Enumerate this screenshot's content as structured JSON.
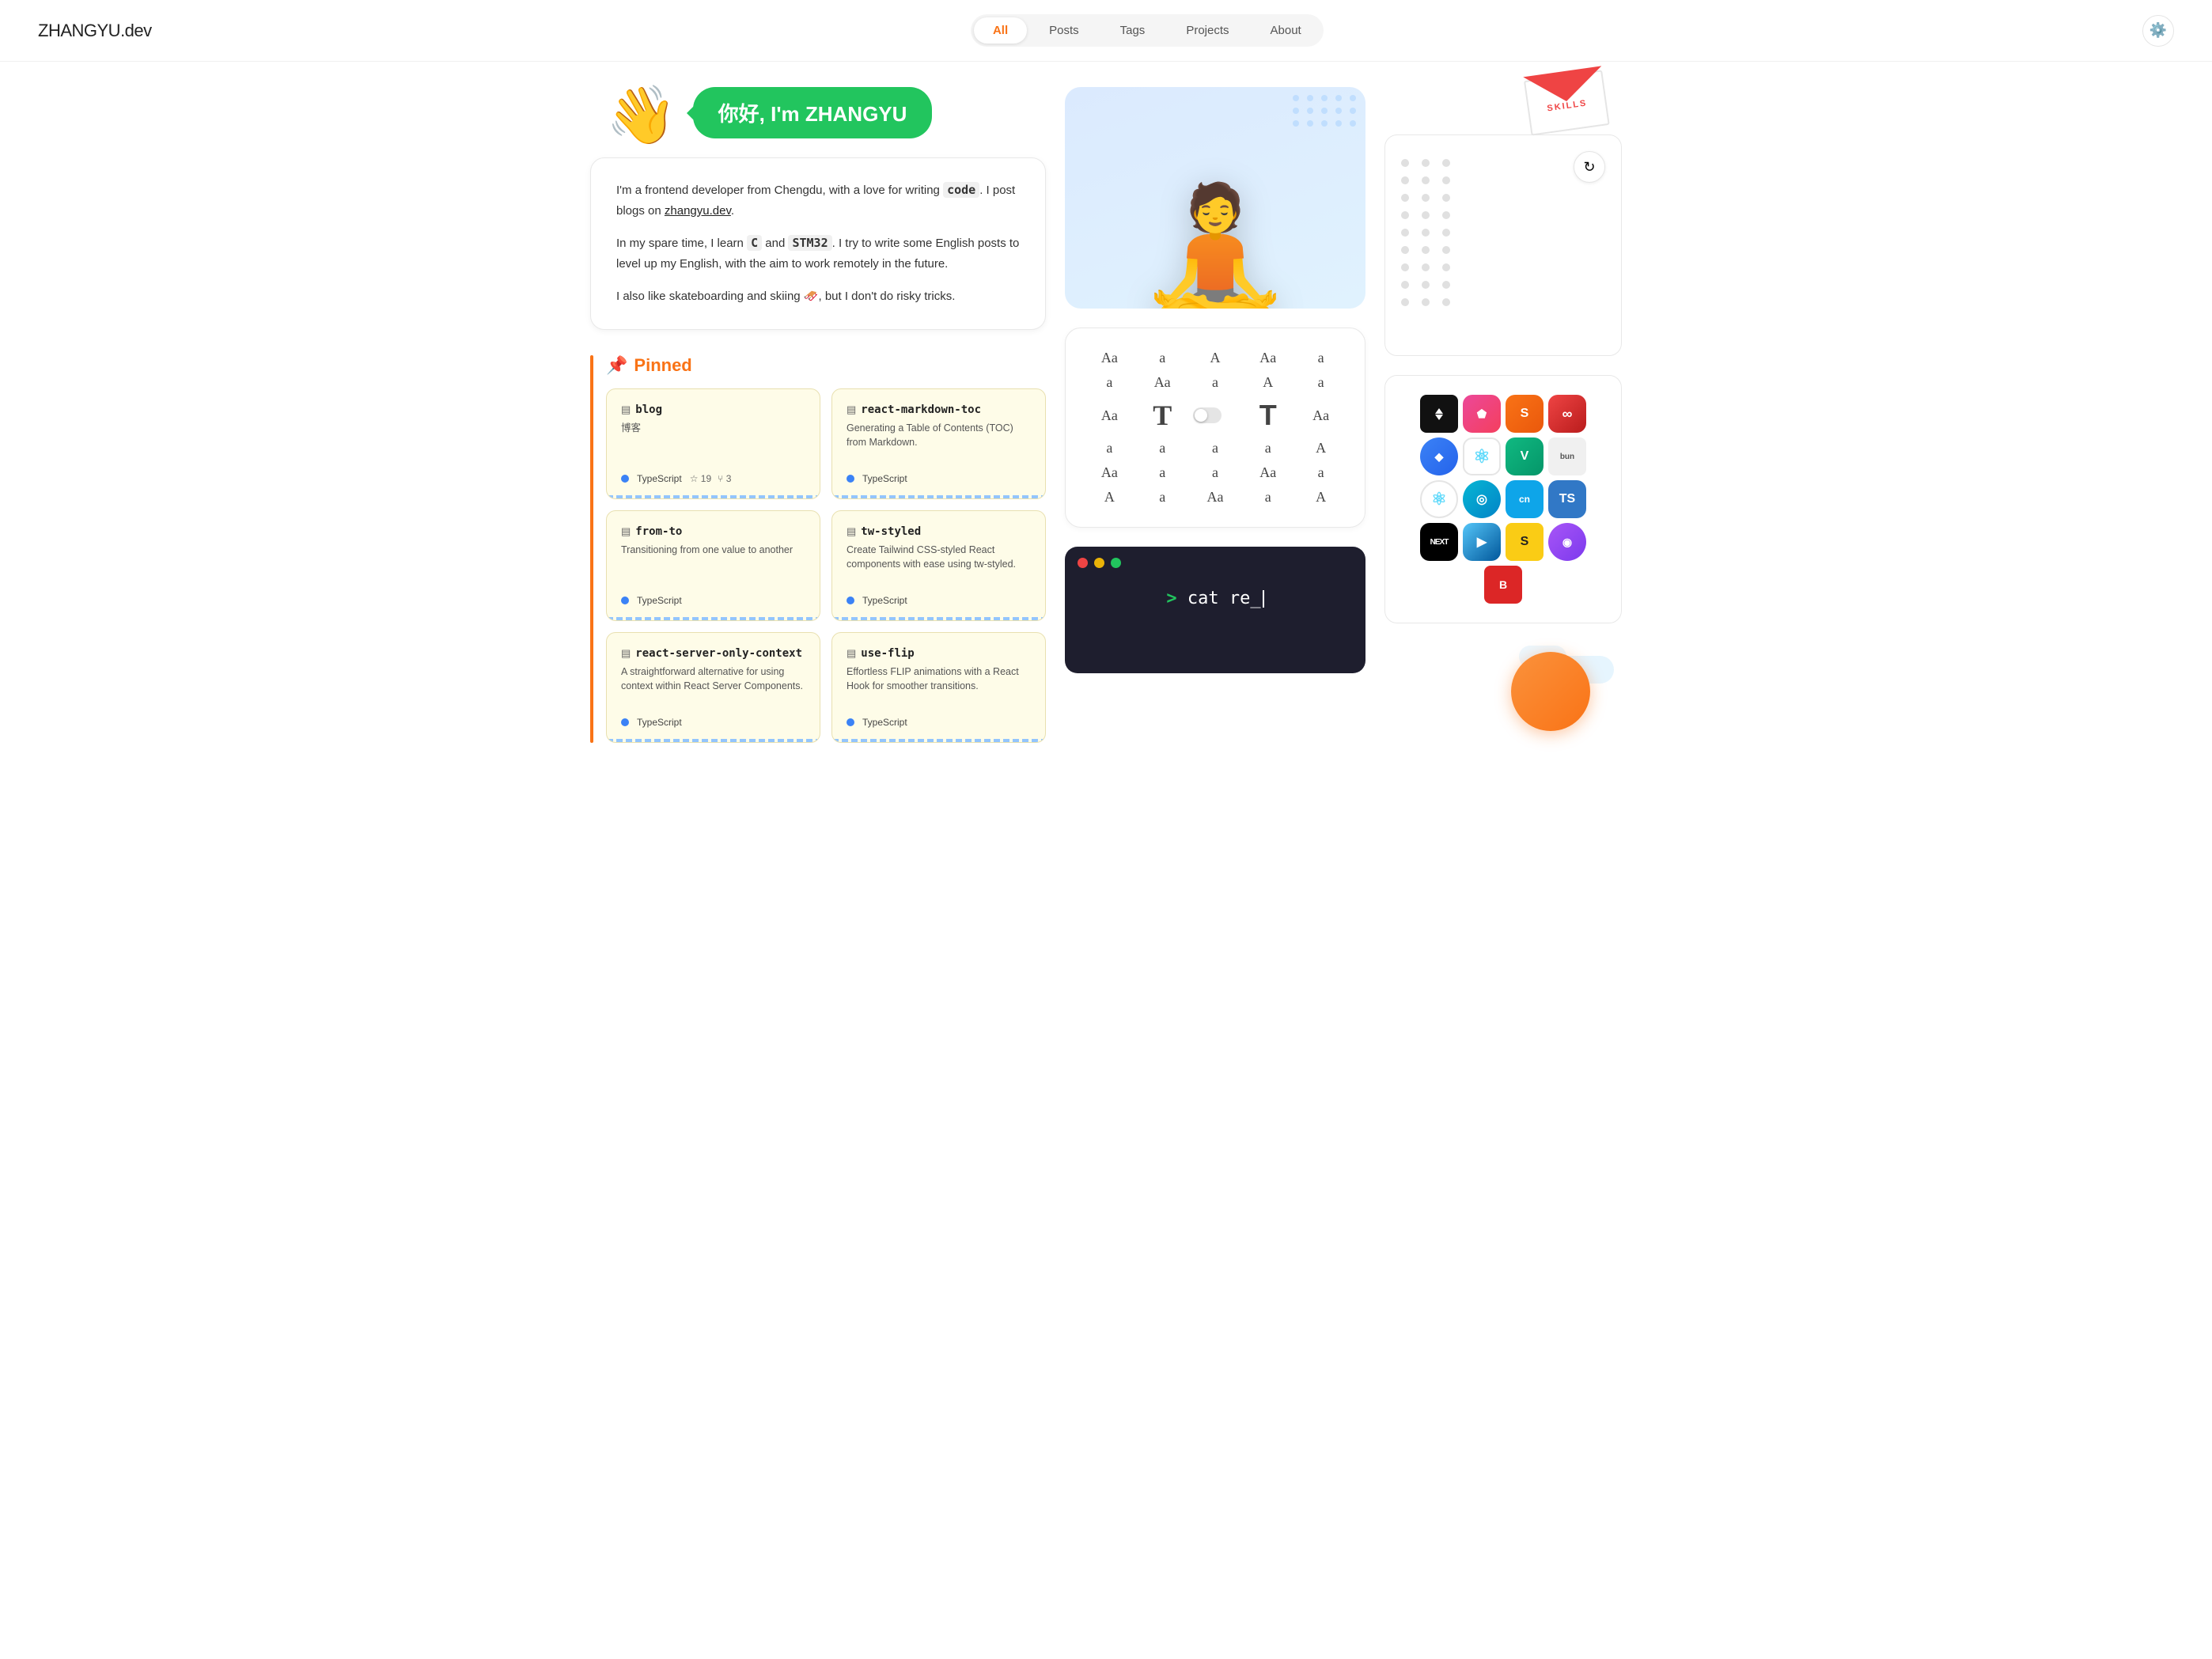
{
  "logo": {
    "text": "ZHANGYU",
    "suffix": ".dev"
  },
  "nav": {
    "items": [
      {
        "id": "all",
        "label": "All",
        "active": true
      },
      {
        "id": "posts",
        "label": "Posts",
        "active": false
      },
      {
        "id": "tags",
        "label": "Tags",
        "active": false
      },
      {
        "id": "projects",
        "label": "Projects",
        "active": false
      },
      {
        "id": "about",
        "label": "About",
        "active": false
      }
    ]
  },
  "intro": {
    "greeting": "你好, I'm ZHANGYU",
    "wave": "👋",
    "paragraph1": "I'm a frontend developer from Chengdu, with a love for writing `code`. I post blogs on zhangyu.dev.",
    "paragraph2": "In my spare time, I learn `C` and `STM32`. I try to write some English posts to level up my English, with the aim to work remotely in the future.",
    "paragraph3": "I also like skateboarding and skiing 🛷, but I don't do risky tricks."
  },
  "pinned": {
    "header": "📌 Pinned",
    "cards": [
      {
        "icon": "▤",
        "title": "blog",
        "subtitle": "博客",
        "desc": "",
        "lang": "TypeScript",
        "stars": 19,
        "forks": 3
      },
      {
        "icon": "▤",
        "title": "react-markdown-toc",
        "subtitle": "",
        "desc": "Generating a Table of Contents (TOC) from Markdown.",
        "lang": "TypeScript",
        "stars": null,
        "forks": null
      },
      {
        "icon": "▤",
        "title": "from-to",
        "subtitle": "",
        "desc": "Transitioning from one value to another",
        "lang": "TypeScript",
        "stars": null,
        "forks": null
      },
      {
        "icon": "▤",
        "title": "tw-styled",
        "subtitle": "",
        "desc": "Create Tailwind CSS-styled React components with ease using tw-styled.",
        "lang": "TypeScript",
        "stars": null,
        "forks": null
      },
      {
        "icon": "▤",
        "title": "react-server-only-context",
        "subtitle": "",
        "desc": "A straightforward alternative for using context within React Server Components.",
        "lang": "TypeScript",
        "stars": null,
        "forks": null
      },
      {
        "icon": "▤",
        "title": "use-flip",
        "subtitle": "",
        "desc": "Effortless FLIP animations with a React Hook for smoother transitions.",
        "lang": "TypeScript",
        "stars": null,
        "forks": null
      }
    ]
  },
  "skills_label": "SKILLS",
  "terminal": {
    "command": "> cat re_"
  },
  "font_chars": [
    "Aa",
    "a",
    "A",
    "Aa",
    "a",
    "a",
    "Aa",
    "a",
    "A",
    "a",
    "Aa",
    "T",
    "",
    "T",
    "Aa",
    "a",
    "a",
    "a",
    "a",
    "A",
    "Aa",
    "a",
    "a",
    "Aa",
    "a",
    "A",
    "a",
    "Aa",
    "a",
    "A"
  ]
}
